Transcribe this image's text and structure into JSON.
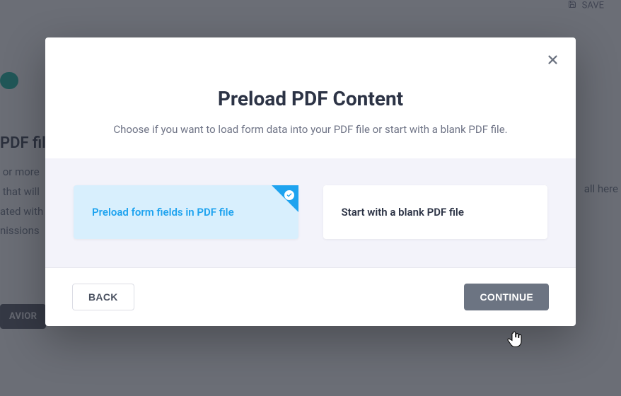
{
  "background": {
    "save_label": "SAVE",
    "heading_fragment": "PDF file",
    "paragraph_fragment": " or more\n that will\nated with\nnissions",
    "right_fragment": "all here",
    "behavior_button_fragment": "AVIOR"
  },
  "modal": {
    "title": "Preload PDF Content",
    "subtitle": "Choose if you want to load form data into your PDF file or start with a blank PDF file.",
    "options": [
      {
        "label": "Preload form fields in PDF file",
        "selected": true
      },
      {
        "label": "Start with a blank PDF file",
        "selected": false
      }
    ],
    "back_label": "BACK",
    "continue_label": "CONTINUE"
  }
}
